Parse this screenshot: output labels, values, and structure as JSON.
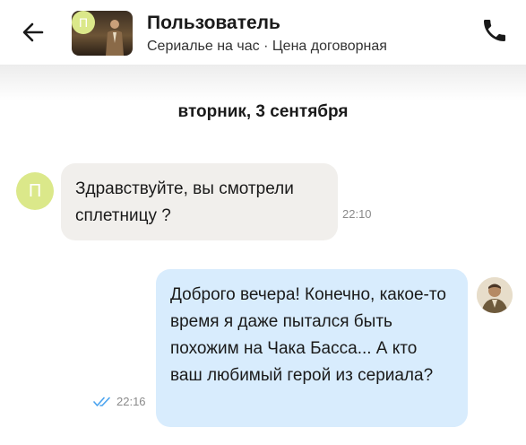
{
  "header": {
    "contact_name": "Пользователь",
    "subtitle": "Сериалье на час · Цена договорная",
    "listing_avatar_letter": "П",
    "icons": {
      "back": "arrow-left-icon",
      "call": "phone-icon"
    }
  },
  "chat": {
    "date_separator": "вторник, 3 сентября",
    "messages": [
      {
        "direction": "incoming",
        "avatar_letter": "П",
        "text": "Здравствуйте, вы смотрели сплетницу ?",
        "time": "22:10"
      },
      {
        "direction": "outgoing",
        "text": "Доброго вечера! Конечно, какое-то время я даже пытался быть похожим на Чака Басса... А кто ваш любимый герой из сериала?",
        "time": "22:16",
        "status": "read"
      }
    ]
  },
  "colors": {
    "avatar_bg": "#dbe88a",
    "incoming_bubble": "#f1efec",
    "outgoing_bubble": "#d8ecfd",
    "read_check": "#4aa3ef"
  }
}
